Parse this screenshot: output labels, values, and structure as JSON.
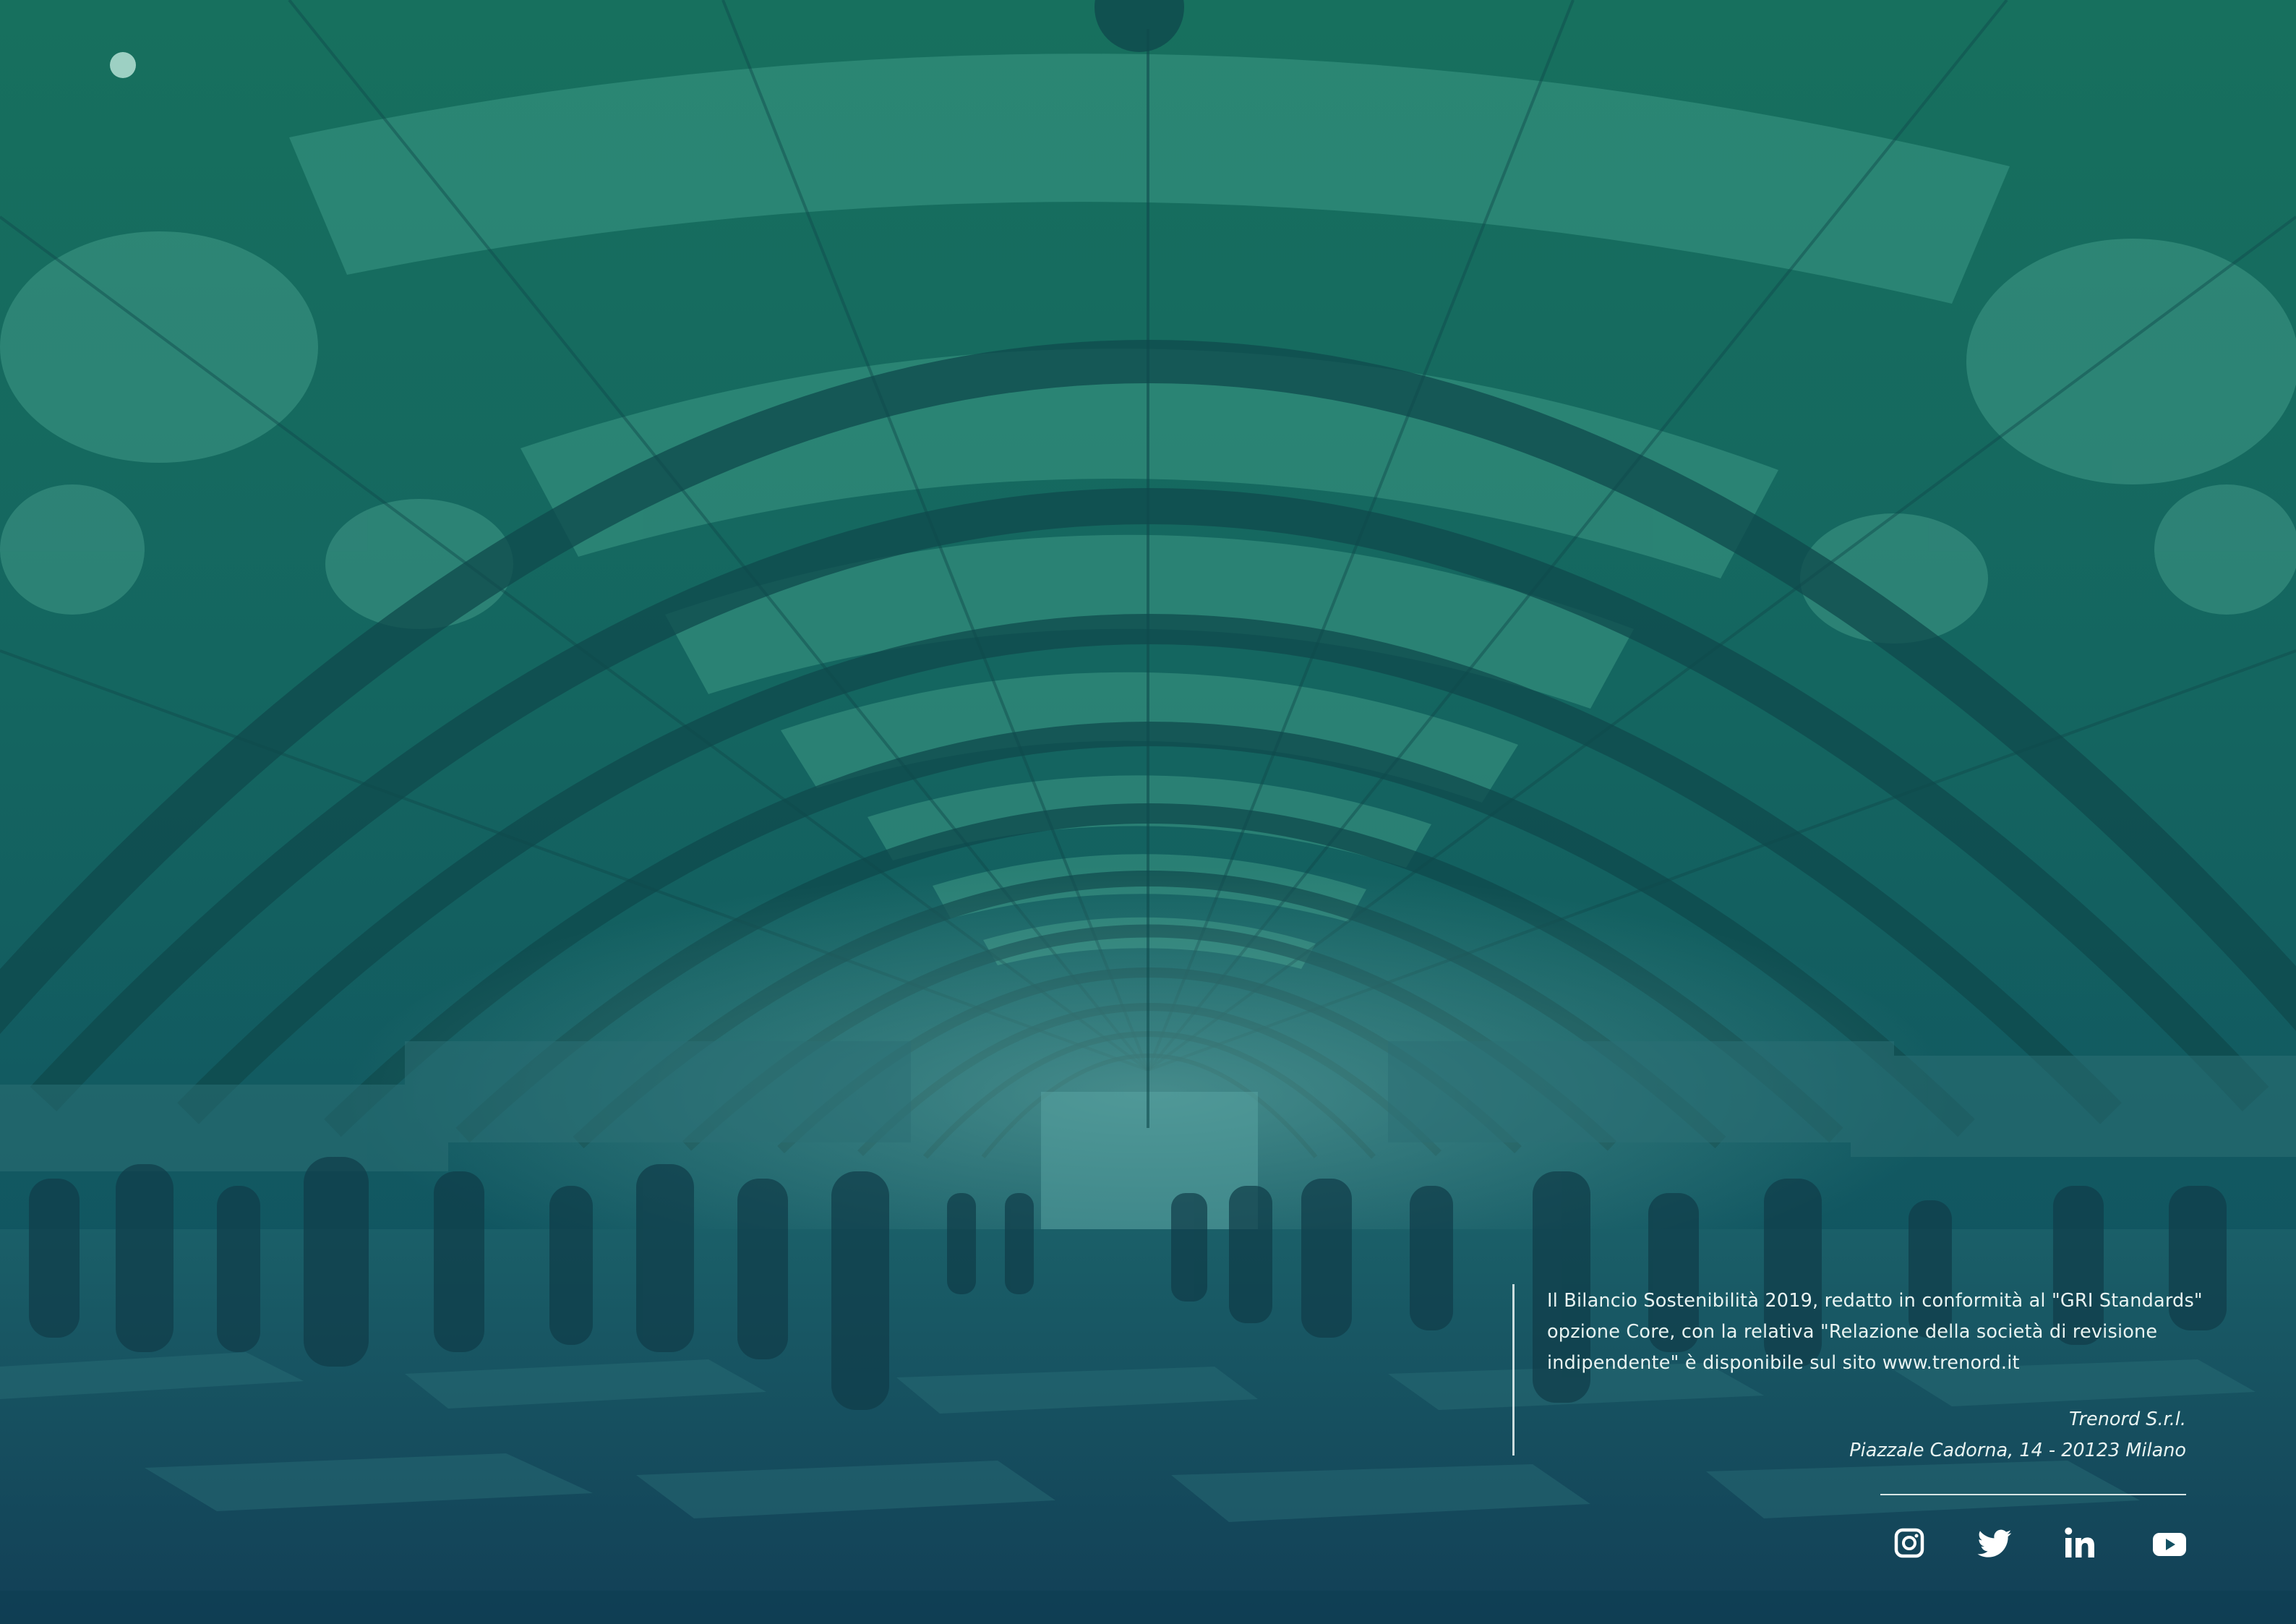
{
  "description_lines": [
    "Il Bilancio Sostenibilità 2019, redatto in conformità al \"GRI Standards\"",
    "opzione Core, con la relativa \"Relazione della società di revisione",
    "indipendente\" è disponibile sul sito www.trenord.it"
  ],
  "company": {
    "name": "Trenord S.r.l.",
    "address": "Piazzale Cadorna, 14 - 20123 Milano"
  },
  "social_icons": [
    "instagram-icon",
    "twitter-icon",
    "linkedin-icon",
    "youtube-icon"
  ],
  "colors": {
    "overlay_top": "#1c6e60",
    "overlay_bottom": "#114f63",
    "text": "#e8f3f1"
  }
}
